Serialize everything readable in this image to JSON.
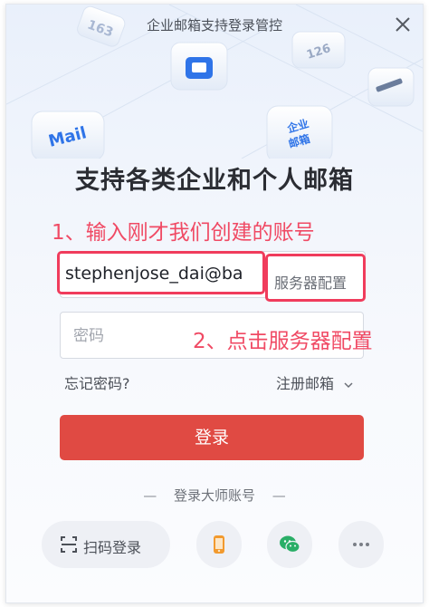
{
  "window": {
    "banner_text": "企业邮箱支持登录管控",
    "headline": "支持各类企业和个人邮箱"
  },
  "hero_tiles": {
    "tile_163": "163",
    "tile_126": "126",
    "tile_mail": "Mail",
    "tile_enterprise": "企业\n邮箱"
  },
  "annotations": {
    "step1": "1、输入刚才我们创建的账号",
    "step2": "2、点击服务器配置"
  },
  "form": {
    "account_value": "stephenjose_dai@ba",
    "server_config_label": "服务器配置",
    "password_placeholder": "密码",
    "forgot_password": "忘记密码?",
    "register_mailbox": "注册邮箱",
    "login_button": "登录"
  },
  "alt_login": {
    "master_account": "登录大师账号",
    "dash": "—",
    "qr_login": "扫码登录"
  },
  "colors": {
    "accent_red": "#e04a43",
    "annotation_red": "#f04a64",
    "wechat_green": "#2aae67",
    "phone_orange": "#f29a2e"
  },
  "icons": {
    "close": "close-icon",
    "chevron": "chevron-down-icon",
    "qr": "scan-icon",
    "phone": "phone-icon",
    "wechat": "wechat-icon",
    "more": "more-icon"
  }
}
